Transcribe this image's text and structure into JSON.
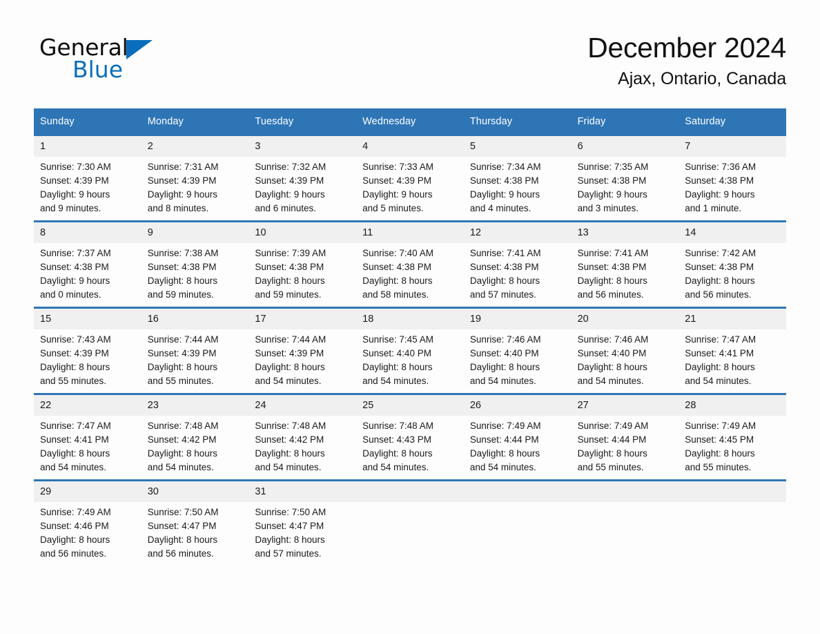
{
  "brand": {
    "name_part1": "General",
    "name_part2": "Blue"
  },
  "header": {
    "title": "December 2024",
    "subtitle": "Ajax, Ontario, Canada"
  },
  "colors": {
    "header_blue": "#2e75b6",
    "logo_blue": "#0a6ebd",
    "daynum_bg": "#f0f0f0",
    "page_bg": "#fdfdfd"
  },
  "weekdays": [
    "Sunday",
    "Monday",
    "Tuesday",
    "Wednesday",
    "Thursday",
    "Friday",
    "Saturday"
  ],
  "weeks": [
    [
      {
        "day": "1",
        "sunrise": "Sunrise: 7:30 AM",
        "sunset": "Sunset: 4:39 PM",
        "daylight1": "Daylight: 9 hours",
        "daylight2": "and 9 minutes."
      },
      {
        "day": "2",
        "sunrise": "Sunrise: 7:31 AM",
        "sunset": "Sunset: 4:39 PM",
        "daylight1": "Daylight: 9 hours",
        "daylight2": "and 8 minutes."
      },
      {
        "day": "3",
        "sunrise": "Sunrise: 7:32 AM",
        "sunset": "Sunset: 4:39 PM",
        "daylight1": "Daylight: 9 hours",
        "daylight2": "and 6 minutes."
      },
      {
        "day": "4",
        "sunrise": "Sunrise: 7:33 AM",
        "sunset": "Sunset: 4:39 PM",
        "daylight1": "Daylight: 9 hours",
        "daylight2": "and 5 minutes."
      },
      {
        "day": "5",
        "sunrise": "Sunrise: 7:34 AM",
        "sunset": "Sunset: 4:38 PM",
        "daylight1": "Daylight: 9 hours",
        "daylight2": "and 4 minutes."
      },
      {
        "day": "6",
        "sunrise": "Sunrise: 7:35 AM",
        "sunset": "Sunset: 4:38 PM",
        "daylight1": "Daylight: 9 hours",
        "daylight2": "and 3 minutes."
      },
      {
        "day": "7",
        "sunrise": "Sunrise: 7:36 AM",
        "sunset": "Sunset: 4:38 PM",
        "daylight1": "Daylight: 9 hours",
        "daylight2": "and 1 minute."
      }
    ],
    [
      {
        "day": "8",
        "sunrise": "Sunrise: 7:37 AM",
        "sunset": "Sunset: 4:38 PM",
        "daylight1": "Daylight: 9 hours",
        "daylight2": "and 0 minutes."
      },
      {
        "day": "9",
        "sunrise": "Sunrise: 7:38 AM",
        "sunset": "Sunset: 4:38 PM",
        "daylight1": "Daylight: 8 hours",
        "daylight2": "and 59 minutes."
      },
      {
        "day": "10",
        "sunrise": "Sunrise: 7:39 AM",
        "sunset": "Sunset: 4:38 PM",
        "daylight1": "Daylight: 8 hours",
        "daylight2": "and 59 minutes."
      },
      {
        "day": "11",
        "sunrise": "Sunrise: 7:40 AM",
        "sunset": "Sunset: 4:38 PM",
        "daylight1": "Daylight: 8 hours",
        "daylight2": "and 58 minutes."
      },
      {
        "day": "12",
        "sunrise": "Sunrise: 7:41 AM",
        "sunset": "Sunset: 4:38 PM",
        "daylight1": "Daylight: 8 hours",
        "daylight2": "and 57 minutes."
      },
      {
        "day": "13",
        "sunrise": "Sunrise: 7:41 AM",
        "sunset": "Sunset: 4:38 PM",
        "daylight1": "Daylight: 8 hours",
        "daylight2": "and 56 minutes."
      },
      {
        "day": "14",
        "sunrise": "Sunrise: 7:42 AM",
        "sunset": "Sunset: 4:38 PM",
        "daylight1": "Daylight: 8 hours",
        "daylight2": "and 56 minutes."
      }
    ],
    [
      {
        "day": "15",
        "sunrise": "Sunrise: 7:43 AM",
        "sunset": "Sunset: 4:39 PM",
        "daylight1": "Daylight: 8 hours",
        "daylight2": "and 55 minutes."
      },
      {
        "day": "16",
        "sunrise": "Sunrise: 7:44 AM",
        "sunset": "Sunset: 4:39 PM",
        "daylight1": "Daylight: 8 hours",
        "daylight2": "and 55 minutes."
      },
      {
        "day": "17",
        "sunrise": "Sunrise: 7:44 AM",
        "sunset": "Sunset: 4:39 PM",
        "daylight1": "Daylight: 8 hours",
        "daylight2": "and 54 minutes."
      },
      {
        "day": "18",
        "sunrise": "Sunrise: 7:45 AM",
        "sunset": "Sunset: 4:40 PM",
        "daylight1": "Daylight: 8 hours",
        "daylight2": "and 54 minutes."
      },
      {
        "day": "19",
        "sunrise": "Sunrise: 7:46 AM",
        "sunset": "Sunset: 4:40 PM",
        "daylight1": "Daylight: 8 hours",
        "daylight2": "and 54 minutes."
      },
      {
        "day": "20",
        "sunrise": "Sunrise: 7:46 AM",
        "sunset": "Sunset: 4:40 PM",
        "daylight1": "Daylight: 8 hours",
        "daylight2": "and 54 minutes."
      },
      {
        "day": "21",
        "sunrise": "Sunrise: 7:47 AM",
        "sunset": "Sunset: 4:41 PM",
        "daylight1": "Daylight: 8 hours",
        "daylight2": "and 54 minutes."
      }
    ],
    [
      {
        "day": "22",
        "sunrise": "Sunrise: 7:47 AM",
        "sunset": "Sunset: 4:41 PM",
        "daylight1": "Daylight: 8 hours",
        "daylight2": "and 54 minutes."
      },
      {
        "day": "23",
        "sunrise": "Sunrise: 7:48 AM",
        "sunset": "Sunset: 4:42 PM",
        "daylight1": "Daylight: 8 hours",
        "daylight2": "and 54 minutes."
      },
      {
        "day": "24",
        "sunrise": "Sunrise: 7:48 AM",
        "sunset": "Sunset: 4:42 PM",
        "daylight1": "Daylight: 8 hours",
        "daylight2": "and 54 minutes."
      },
      {
        "day": "25",
        "sunrise": "Sunrise: 7:48 AM",
        "sunset": "Sunset: 4:43 PM",
        "daylight1": "Daylight: 8 hours",
        "daylight2": "and 54 minutes."
      },
      {
        "day": "26",
        "sunrise": "Sunrise: 7:49 AM",
        "sunset": "Sunset: 4:44 PM",
        "daylight1": "Daylight: 8 hours",
        "daylight2": "and 54 minutes."
      },
      {
        "day": "27",
        "sunrise": "Sunrise: 7:49 AM",
        "sunset": "Sunset: 4:44 PM",
        "daylight1": "Daylight: 8 hours",
        "daylight2": "and 55 minutes."
      },
      {
        "day": "28",
        "sunrise": "Sunrise: 7:49 AM",
        "sunset": "Sunset: 4:45 PM",
        "daylight1": "Daylight: 8 hours",
        "daylight2": "and 55 minutes."
      }
    ],
    [
      {
        "day": "29",
        "sunrise": "Sunrise: 7:49 AM",
        "sunset": "Sunset: 4:46 PM",
        "daylight1": "Daylight: 8 hours",
        "daylight2": "and 56 minutes."
      },
      {
        "day": "30",
        "sunrise": "Sunrise: 7:50 AM",
        "sunset": "Sunset: 4:47 PM",
        "daylight1": "Daylight: 8 hours",
        "daylight2": "and 56 minutes."
      },
      {
        "day": "31",
        "sunrise": "Sunrise: 7:50 AM",
        "sunset": "Sunset: 4:47 PM",
        "daylight1": "Daylight: 8 hours",
        "daylight2": "and 57 minutes."
      },
      {
        "day": "",
        "sunrise": "",
        "sunset": "",
        "daylight1": "",
        "daylight2": ""
      },
      {
        "day": "",
        "sunrise": "",
        "sunset": "",
        "daylight1": "",
        "daylight2": ""
      },
      {
        "day": "",
        "sunrise": "",
        "sunset": "",
        "daylight1": "",
        "daylight2": ""
      },
      {
        "day": "",
        "sunrise": "",
        "sunset": "",
        "daylight1": "",
        "daylight2": ""
      }
    ]
  ]
}
